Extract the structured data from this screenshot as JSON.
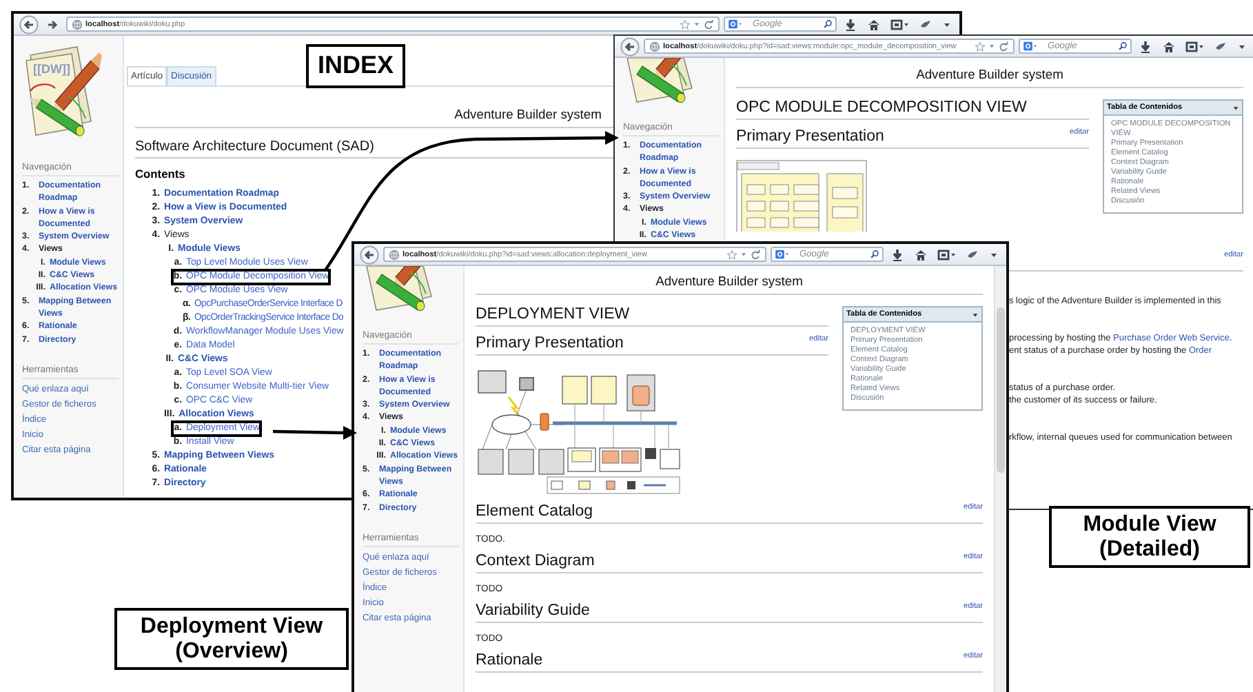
{
  "callouts": [
    {
      "lines": [
        "INDEX"
      ]
    },
    {
      "lines": [
        "Module View",
        "(Detailed)"
      ]
    },
    {
      "lines": [
        "Deployment View",
        "(Overview)"
      ]
    }
  ],
  "index_window": {
    "url": "**localhost**/dokuwiki/doku.php",
    "forward_button": true,
    "search_placeholder": "Google",
    "logo_text": "[[DW]]",
    "tabs": [
      {
        "label": "Artículo",
        "selected": true
      },
      {
        "label": "Discusión",
        "selected": false
      }
    ],
    "site_title": "Adventure Builder system",
    "page_title": "Software Architecture Document (SAD)",
    "contents_heading": "Contents",
    "contents": [
      {
        "number": "1.",
        "label": "Documentation Roadmap",
        "link": true,
        "boxed": false
      },
      {
        "number": "2.",
        "label": "How a View is Documented",
        "link": true,
        "boxed": false
      },
      {
        "number": "3.",
        "label": "System Overview",
        "link": true,
        "boxed": false
      },
      {
        "number": "4.",
        "label": "Views",
        "link": false,
        "boxed": false,
        "children": [
          {
            "number": "I.",
            "label": "Module Views",
            "link": true,
            "boxed": false,
            "children": [
              {
                "number": "a.",
                "label": "Top Level Module Uses View",
                "link": true,
                "boxed": false
              },
              {
                "number": "b.",
                "label": "OPC Module Decomposition View",
                "link": true,
                "boxed": true
              },
              {
                "number": "c.",
                "label": "OPC Module Uses View",
                "link": true,
                "boxed": false,
                "children": [
                  {
                    "number": "α.",
                    "label": "OpcPurchaseOrderService Interface D",
                    "link": true,
                    "boxed": false
                  },
                  {
                    "number": "β.",
                    "label": "OpcOrderTrackingService Interface Do",
                    "link": true,
                    "boxed": false
                  }
                ]
              },
              {
                "number": "d.",
                "label": "WorkflowManager Module Uses View",
                "link": true,
                "boxed": false
              },
              {
                "number": "e.",
                "label": "Data Model",
                "link": true,
                "boxed": false
              }
            ]
          },
          {
            "number": "II.",
            "label": "C&C Views",
            "link": true,
            "boxed": false,
            "children": [
              {
                "number": "a.",
                "label": "Top Level SOA View",
                "link": true,
                "boxed": false
              },
              {
                "number": "b.",
                "label": "Consumer Website Multi-tier View",
                "link": true,
                "boxed": false
              },
              {
                "number": "c.",
                "label": "OPC C&C View",
                "link": true,
                "boxed": false
              }
            ]
          },
          {
            "number": "III.",
            "label": "Allocation Views",
            "link": true,
            "boxed": false,
            "children": [
              {
                "number": "a.",
                "label": "Deployment View",
                "link": true,
                "boxed": true
              },
              {
                "number": "b.",
                "label": "Install View",
                "link": true,
                "boxed": false
              }
            ]
          }
        ]
      },
      {
        "number": "5.",
        "label": "Mapping Between Views",
        "link": true,
        "boxed": false
      },
      {
        "number": "6.",
        "label": "Rationale",
        "link": true,
        "boxed": false
      },
      {
        "number": "7.",
        "label": "Directory",
        "link": true,
        "boxed": false
      }
    ],
    "nav_heading": "Navegación",
    "nav": [
      {
        "number": "1.",
        "label": "Documentation Roadmap",
        "link": true
      },
      {
        "number": "2.",
        "label": "How a View is Documented",
        "link": true
      },
      {
        "number": "3.",
        "label": "System Overview",
        "link": true
      },
      {
        "number": "4.",
        "label": "Views",
        "link": false,
        "children": [
          {
            "number": "I.",
            "label": "Module Views",
            "link": true
          },
          {
            "number": "II.",
            "label": "C&C Views",
            "link": true
          },
          {
            "number": "III.",
            "label": "Allocation Views",
            "link": true
          }
        ]
      },
      {
        "number": "5.",
        "label": "Mapping Between Views",
        "link": true
      },
      {
        "number": "6.",
        "label": "Rationale",
        "link": true
      },
      {
        "number": "7.",
        "label": "Directory",
        "link": true
      }
    ],
    "tools_heading": "Herramientas",
    "tools": [
      "Qué enlaza aquí",
      "Gestor de ficheros",
      "Índice",
      "Inicio",
      "Citar esta página"
    ]
  },
  "module_window": {
    "url": "**localhost**/dokuwiki/doku.php?id=sad:views:module:opc_module_decomposition_view",
    "search_placeholder": "Google",
    "site_title": "Adventure Builder system",
    "page_title": "OPC MODULE DECOMPOSITION VIEW",
    "sections": [
      {
        "title": "Primary Presentation",
        "edit_label": "editar",
        "kind": "diagram"
      }
    ],
    "toc": {
      "title": "Tabla de Contenidos",
      "items": [
        "OPC MODULE DECOMPOSITION VIEW",
        "Primary Presentation",
        "Element Catalog",
        "Context Diagram",
        "Variability Guide",
        "Rationale",
        "Related Views",
        "Discusión"
      ]
    },
    "nav_heading": "Navegación",
    "nav": [
      {
        "number": "1.",
        "label": "Documentation Roadmap",
        "link": true
      },
      {
        "number": "2.",
        "label": "How a View is Documented",
        "link": true
      },
      {
        "number": "3.",
        "label": "System Overview",
        "link": true
      },
      {
        "number": "4.",
        "label": "Views",
        "link": false,
        "children": [
          {
            "number": "I.",
            "label": "Module Views",
            "link": true
          },
          {
            "number": "II.",
            "label": "C&C Views",
            "link": true
          }
        ]
      }
    ],
    "fragment": {
      "edit_label": "editar",
      "paragraphs": [
        [
          [
            {
              "text": "s logic of the Adventure Builder is implemented in this",
              "link": false
            }
          ]
        ],
        [
          [
            {
              "text": "processing by hosting the ",
              "link": false
            },
            {
              "text": "Purchase Order Web Service",
              "link": true
            },
            {
              "text": ".",
              "link": false
            }
          ],
          [
            {
              "text": "ent status of a purchase order by hosting the ",
              "link": false
            },
            {
              "text": "Order",
              "link": true
            }
          ]
        ],
        [
          [
            {
              "text": "status of a purchase order.",
              "link": false
            }
          ],
          [
            {
              "text": "the customer of its success or failure.",
              "link": false
            }
          ]
        ],
        [
          [
            {
              "text": "rkflow, internal queues used for communication between",
              "link": false
            }
          ]
        ]
      ]
    }
  },
  "deployment_window": {
    "url": "**localhost**/dokuwiki/doku.php?id=sad:views:allocation:deployment_view",
    "search_placeholder": "Google",
    "site_title": "Adventure Builder system",
    "page_title": "DEPLOYMENT VIEW",
    "sections": [
      {
        "title": "Primary Presentation",
        "edit_label": "editar",
        "kind": "diagram"
      },
      {
        "title": "Element Catalog",
        "edit_label": "editar",
        "kind": "text",
        "body": "TODO."
      },
      {
        "title": "Context Diagram",
        "edit_label": "editar",
        "kind": "text",
        "body": "TODO"
      },
      {
        "title": "Variability Guide",
        "edit_label": "editar",
        "kind": "text",
        "body": "TODO"
      },
      {
        "title": "Rationale",
        "edit_label": "editar",
        "kind": "text"
      }
    ],
    "toc": {
      "title": "Tabla de Contenidos",
      "items": [
        "DEPLOYMENT VIEW",
        "Primary Presentation",
        "Element Catalog",
        "Context Diagram",
        "Variability Guide",
        "Rationale",
        "Related Views",
        "Discusión"
      ]
    },
    "nav_heading": "Navegación",
    "nav": [
      {
        "number": "1.",
        "label": "Documentation Roadmap",
        "link": true
      },
      {
        "number": "2.",
        "label": "How a View is Documented",
        "link": true
      },
      {
        "number": "3.",
        "label": "System Overview",
        "link": true
      },
      {
        "number": "4.",
        "label": "Views",
        "link": false,
        "children": [
          {
            "number": "I.",
            "label": "Module Views",
            "link": true
          },
          {
            "number": "II.",
            "label": "C&C Views",
            "link": true
          },
          {
            "number": "III.",
            "label": "Allocation Views",
            "link": true
          }
        ]
      },
      {
        "number": "5.",
        "label": "Mapping Between Views",
        "link": true
      },
      {
        "number": "6.",
        "label": "Rationale",
        "link": true
      },
      {
        "number": "7.",
        "label": "Directory",
        "link": true
      }
    ],
    "tools_heading": "Herramientas",
    "tools": [
      "Qué enlaza aquí",
      "Gestor de ficheros",
      "Índice",
      "Inicio",
      "Citar esta página"
    ]
  }
}
